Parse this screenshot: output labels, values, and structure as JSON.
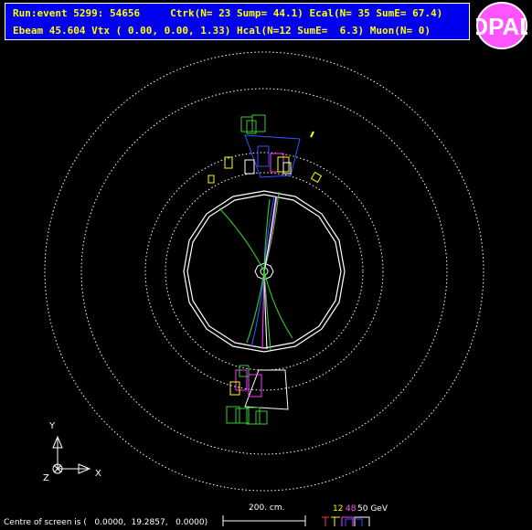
{
  "header": {
    "line1": "Run:event 5299: 54656     Ctrk(N= 23 Sump= 44.1) Ecal(N= 35 SumE= 67.4)",
    "line2": "Ebeam 45.604 Vtx ( 0.00, 0.00, 1.33) Hcal(N=12 SumE=  6.3) Muon(N= 0)"
  },
  "logo": {
    "text": "OPAL",
    "bg_color": "#ff55ff",
    "letter_color": "#ffffff"
  },
  "axes": {
    "y_label": "Y",
    "x_label": "X",
    "z_label": "Z"
  },
  "scale": {
    "label": "200. cm."
  },
  "energy_legend": {
    "labels": [
      "12",
      "48",
      "50 GeV"
    ],
    "colors": [
      "#ffff00",
      "#ff55ff",
      "#ffffff"
    ]
  },
  "footer": {
    "centre_text": "Centre of screen is (   0.0000,  19.2857,   0.0000)"
  },
  "colors": {
    "background": "#000000",
    "header_bg": "#0000ee",
    "header_text": "#ffff00",
    "tracks_green": "#33cc33",
    "tracks_blue": "#3355ff",
    "tracks_magenta": "#ff33ff",
    "ecal_yellow": "#ffff00"
  }
}
